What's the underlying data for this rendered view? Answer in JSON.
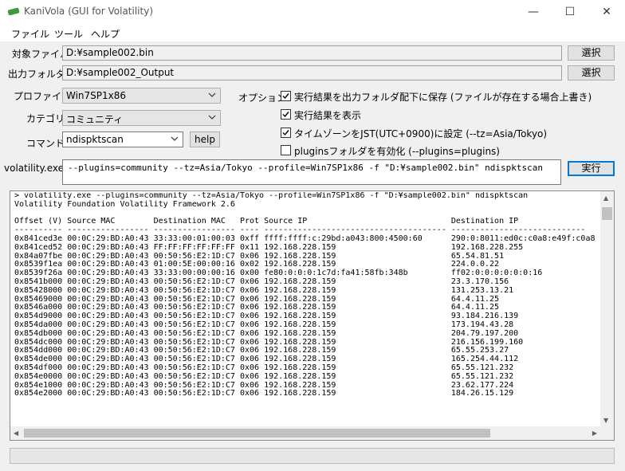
{
  "window": {
    "title": "KaniVola (GUI for Volatility)",
    "minimize": "—",
    "maximize": "☐",
    "close": "✕"
  },
  "menu": [
    "ファイル",
    "ツール",
    "ヘルプ"
  ],
  "target_file": {
    "label": "対象ファイル",
    "value": "D:¥sample002.bin",
    "button": "選択"
  },
  "output_folder": {
    "label": "出力フォルダ",
    "value": "D:¥sample002_Output",
    "button": "選択"
  },
  "profile": {
    "label": "プロファイル",
    "value": "Win7SP1x86"
  },
  "category": {
    "label": "カテゴリ",
    "value": "コミュニティ"
  },
  "command": {
    "label": "コマンド",
    "value": "ndispktscan",
    "help_button": "help"
  },
  "options": {
    "label": "オプション",
    "items": [
      {
        "label": "実行結果を出力フォルダ配下に保存 (ファイルが存在する場合上書き)",
        "checked": true
      },
      {
        "label": "実行結果を表示",
        "checked": true
      },
      {
        "label": "タイムゾーンをJST(UTC+0900)に設定 (--tz=Asia/Tokyo)",
        "checked": true
      },
      {
        "label": "pluginsフォルダを有効化 (--plugins=plugins)",
        "checked": false
      }
    ]
  },
  "volatility": {
    "label": "volatility.exe",
    "args": "--plugins=community --tz=Asia/Tokyo --profile=Win7SP1x86 -f \"D:¥sample002.bin\" ndispktscan",
    "run_button": "実行"
  },
  "console": {
    "lines": [
      "> volatility.exe --plugins=community --tz=Asia/Tokyo --profile=Win7SP1x86 -f \"D:¥sample002.bin\" ndispktscan",
      "Volatility Foundation Volatility Framework 2.6",
      "",
      "Offset (V) Source MAC        Destination MAC   Prot Source IP                              Destination IP",
      "---------- ----------------- ----------------- ---- -------------------------------------- ----------------------------",
      "0x841ced3e 00:0C:29:BD:A0:43 33:33:00:01:00:03 0xff ffff:ffff:c:29bd:a043:800:4500:60      290:0:8011:ed0c:c0a8:e49f:c0a8",
      "0x841ced52 00:0C:29:BD:A0:43 FF:FF:FF:FF:FF:FF 0x11 192.168.228.159                        192.168.228.255",
      "0x84a07fbe 00:0C:29:BD:A0:43 00:50:56:E2:1D:C7 0x06 192.168.228.159                        65.54.81.51",
      "0x8539f1ea 00:0C:29:BD:A0:43 01:00:5E:00:00:16 0x02 192.168.228.159                        224.0.0.22",
      "0x8539f26a 00:0C:29:BD:A0:43 33:33:00:00:00:16 0x00 fe80:0:0:0:1c7d:fa41:58fb:348b         ff02:0:0:0:0:0:0:16",
      "0x8541b000 00:0C:29:BD:A0:43 00:50:56:E2:1D:C7 0x06 192.168.228.159                        23.3.170.156",
      "0x85428000 00:0C:29:BD:A0:43 00:50:56:E2:1D:C7 0x06 192.168.228.159                        131.253.13.21",
      "0x85469000 00:0C:29:BD:A0:43 00:50:56:E2:1D:C7 0x06 192.168.228.159                        64.4.11.25",
      "0x8546a000 00:0C:29:BD:A0:43 00:50:56:E2:1D:C7 0x06 192.168.228.159                        64.4.11.25",
      "0x854d9000 00:0C:29:BD:A0:43 00:50:56:E2:1D:C7 0x06 192.168.228.159                        93.184.216.139",
      "0x854da000 00:0C:29:BD:A0:43 00:50:56:E2:1D:C7 0x06 192.168.228.159                        173.194.43.28",
      "0x854db000 00:0C:29:BD:A0:43 00:50:56:E2:1D:C7 0x06 192.168.228.159                        204.79.197.200",
      "0x854dc000 00:0C:29:BD:A0:43 00:50:56:E2:1D:C7 0x06 192.168.228.159                        216.156.199.160",
      "0x854dd000 00:0C:29:BD:A0:43 00:50:56:E2:1D:C7 0x06 192.168.228.159                        65.55.253.27",
      "0x854de000 00:0C:29:BD:A0:43 00:50:56:E2:1D:C7 0x06 192.168.228.159                        165.254.44.112",
      "0x854df000 00:0C:29:BD:A0:43 00:50:56:E2:1D:C7 0x06 192.168.228.159                        65.55.121.232",
      "0x854e0000 00:0C:29:BD:A0:43 00:50:56:E2:1D:C7 0x06 192.168.228.159                        65.55.121.232",
      "0x854e1000 00:0C:29:BD:A0:43 00:50:56:E2:1D:C7 0x06 192.168.228.159                        23.62.177.224",
      "0x854e2000 00:0C:29:BD:A0:43 00:50:56:E2:1D:C7 0x06 192.168.228.159                        184.26.15.129"
    ]
  },
  "status": ""
}
